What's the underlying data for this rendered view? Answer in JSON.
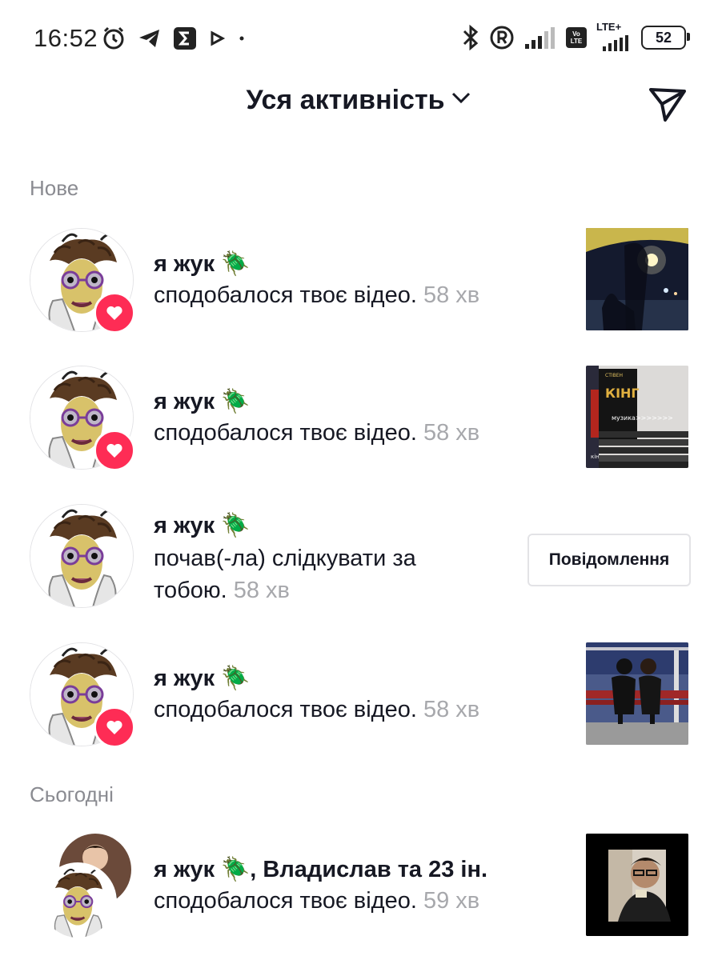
{
  "status_bar": {
    "time": "16:52",
    "battery": "52",
    "network": "LTE+",
    "volte_top": "Vo",
    "volte_bottom": "LTE",
    "left_icons": [
      "alarm-icon",
      "telegram-icon",
      "sigma-app-icon",
      "play-icon",
      "dot-icon"
    ],
    "right_icons": [
      "bluetooth-icon",
      "registered-icon",
      "signal-icon",
      "volte-icon",
      "lte-signal-icon",
      "battery-icon"
    ]
  },
  "header": {
    "title": "Уся активність",
    "dropdown_icon": "chevron-down-icon",
    "send_icon": "send-icon"
  },
  "sections": {
    "new_label": "Нове",
    "today_label": "Сьогодні"
  },
  "notifications": [
    {
      "name": "я жук",
      "emoji": "🪲",
      "action": "сподобалося твоє відео.",
      "time": "58 хв",
      "type": "like"
    },
    {
      "name": "я жук",
      "emoji": "🪲",
      "action": "сподобалося твоє відео.",
      "time": "58 хв",
      "type": "like",
      "thumb_text_title": "КІНГ",
      "thumb_text_author": "СТІВЕН",
      "thumb_text_caption": "музика>>>>>>>",
      "thumb_text_spine": "кінг"
    },
    {
      "name": "я жук",
      "emoji": "🪲",
      "action": "почав(-ла) слідкувати за тобою.",
      "time": "58 хв",
      "type": "follow",
      "button": "Повідомлення"
    },
    {
      "name": "я жук",
      "emoji": "🪲",
      "action": "сподобалося твоє відео.",
      "time": "58 хв",
      "type": "like"
    },
    {
      "name": "я жук",
      "emoji": "🪲",
      "name_suffix": ", Владислав та 23 ін.",
      "action": "сподобалося твоє відео.",
      "time": "59 хв",
      "type": "like-group"
    }
  ],
  "colors": {
    "accent": "#fe2c55",
    "text": "#161823",
    "muted": "#a7a8ac",
    "section": "#8a8b91"
  }
}
